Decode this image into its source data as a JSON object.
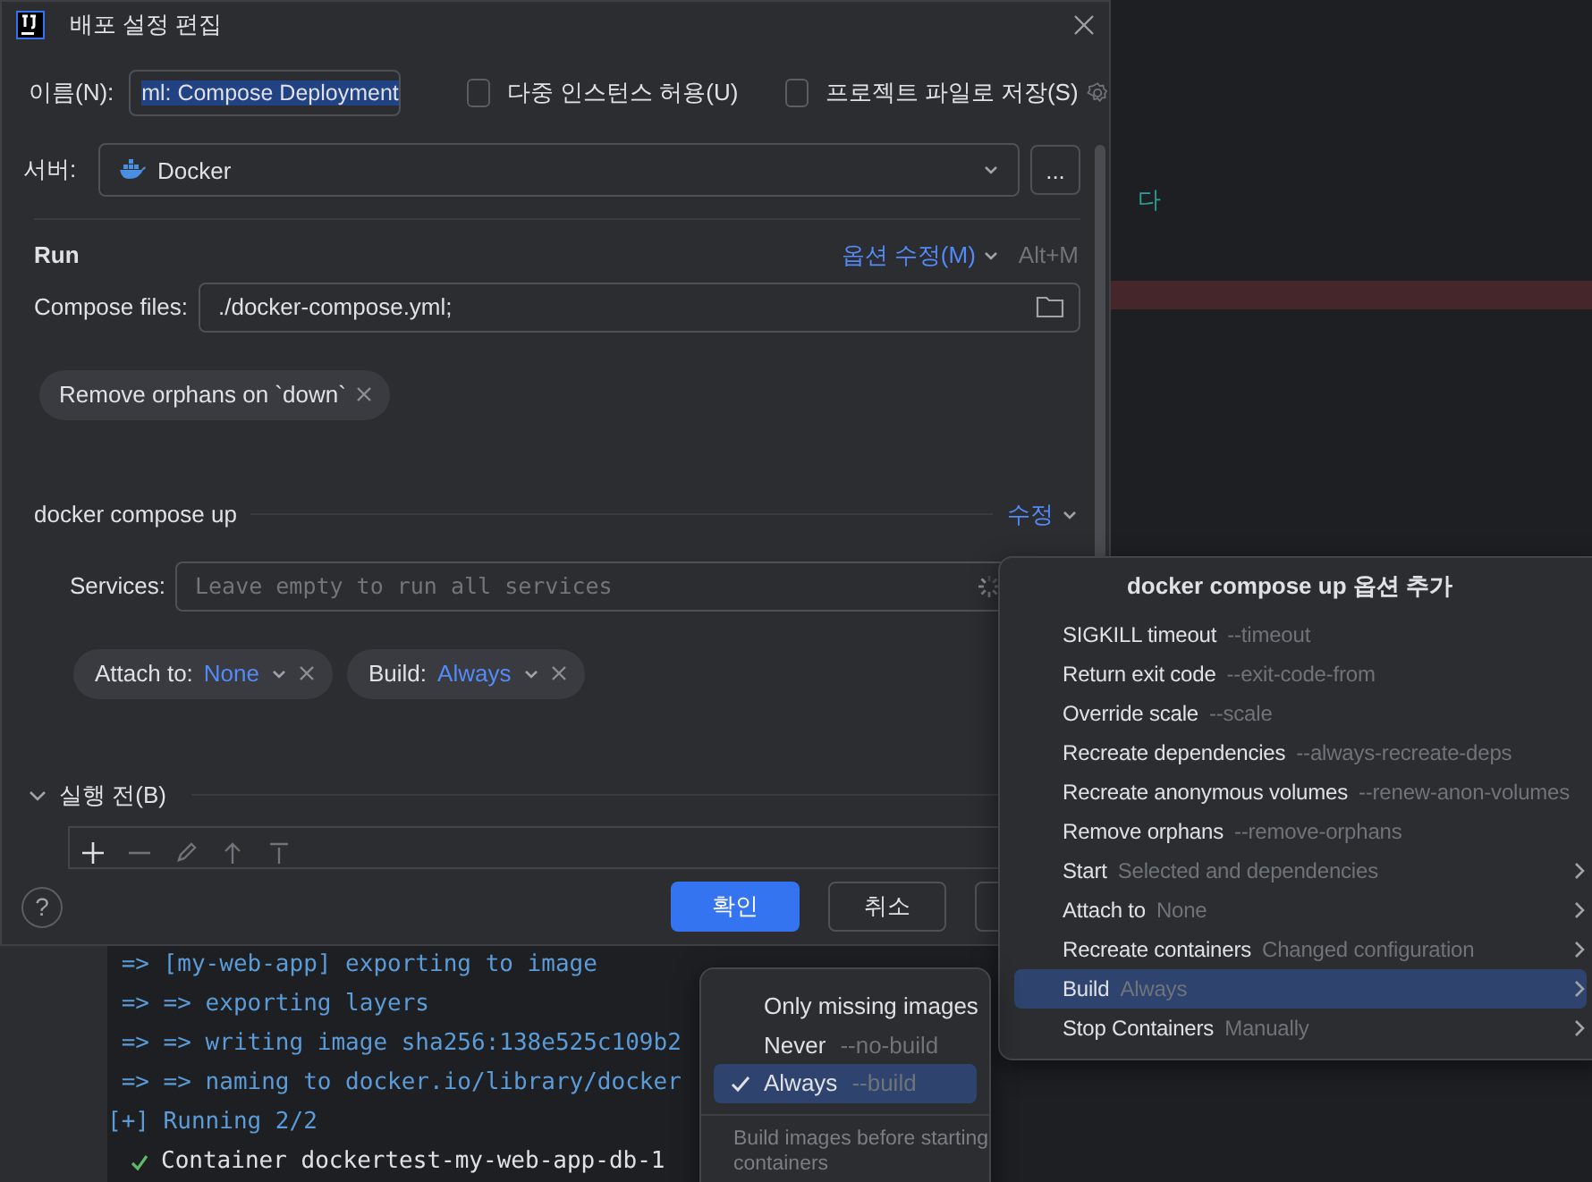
{
  "editor": {
    "text": "다"
  },
  "terminal": {
    "lines": [
      {
        "kind": "output",
        "text": " => [my-web-app] exporting to image"
      },
      {
        "kind": "output",
        "text": " => => exporting layers"
      },
      {
        "kind": "output",
        "text": " => => writing image sha256:138e525c109b2"
      },
      {
        "kind": "output",
        "text": " => => naming to docker.io/library/docker"
      },
      {
        "kind": "output",
        "text": "[+] Running 2/2"
      },
      {
        "kind": "done",
        "text": "Container dockertest-my-web-app-db-1"
      }
    ]
  },
  "dialog": {
    "title": "배포 설정 편집",
    "name_field": {
      "label": "이름(N):",
      "value": "ml: Compose Deployment"
    },
    "checkboxes": [
      {
        "label": "다중 인스턴스 허용(U)",
        "checked": false
      },
      {
        "label": "프로젝트 파일로 저장(S)",
        "checked": false
      }
    ],
    "server": {
      "label": "서버:",
      "value": "Docker",
      "more": "..."
    },
    "run": {
      "heading": "Run",
      "modify_options": "옵션 수정(M)",
      "shortcut": "Alt+M"
    },
    "compose_files": {
      "label": "Compose files:",
      "value": "./docker-compose.yml;"
    },
    "run_chips": [
      {
        "label": "Remove orphans on `down`"
      }
    ],
    "compose_up": {
      "heading": "docker compose up",
      "modify": "수정"
    },
    "services": {
      "label": "Services:",
      "placeholder": "Leave empty to run all services"
    },
    "option_chips": [
      {
        "label": "Attach to:",
        "value": "None"
      },
      {
        "label": "Build:",
        "value": "Always"
      }
    ],
    "before_launch": {
      "heading": "실행 전(B)",
      "expanded": true
    },
    "help": "?",
    "buttons": [
      {
        "label": "확인",
        "kind": "primary"
      },
      {
        "label": "취소",
        "kind": "secondary"
      }
    ]
  },
  "options_menu": {
    "title": "docker compose up 옵션 추가",
    "items": [
      {
        "name": "SIGKILL timeout",
        "hint": "--timeout",
        "submenu": false,
        "selected": false
      },
      {
        "name": "Return exit code",
        "hint": "--exit-code-from",
        "submenu": false,
        "selected": false
      },
      {
        "name": "Override scale",
        "hint": "--scale",
        "submenu": false,
        "selected": false
      },
      {
        "name": "Recreate dependencies",
        "hint": "--always-recreate-deps",
        "submenu": false,
        "selected": false
      },
      {
        "name": "Recreate anonymous volumes",
        "hint": "--renew-anon-volumes",
        "submenu": false,
        "selected": false
      },
      {
        "name": "Remove orphans",
        "hint": "--remove-orphans",
        "submenu": false,
        "selected": false
      },
      {
        "name": "Start",
        "hint": "Selected and dependencies",
        "submenu": true,
        "selected": false
      },
      {
        "name": "Attach to",
        "hint": "None",
        "submenu": true,
        "selected": false
      },
      {
        "name": "Recreate containers",
        "hint": "Changed configuration",
        "submenu": true,
        "selected": false
      },
      {
        "name": "Build",
        "hint": "Always",
        "submenu": true,
        "selected": true
      },
      {
        "name": "Stop Containers",
        "hint": "Manually",
        "submenu": true,
        "selected": false
      }
    ]
  },
  "build_menu": {
    "items": [
      {
        "label": "Only missing images",
        "selected": false
      },
      {
        "label": "Never",
        "hint": "--no-build",
        "selected": false
      },
      {
        "label": "Always",
        "hint": "--build",
        "selected": true
      }
    ],
    "description": "Build images before starting containers"
  }
}
